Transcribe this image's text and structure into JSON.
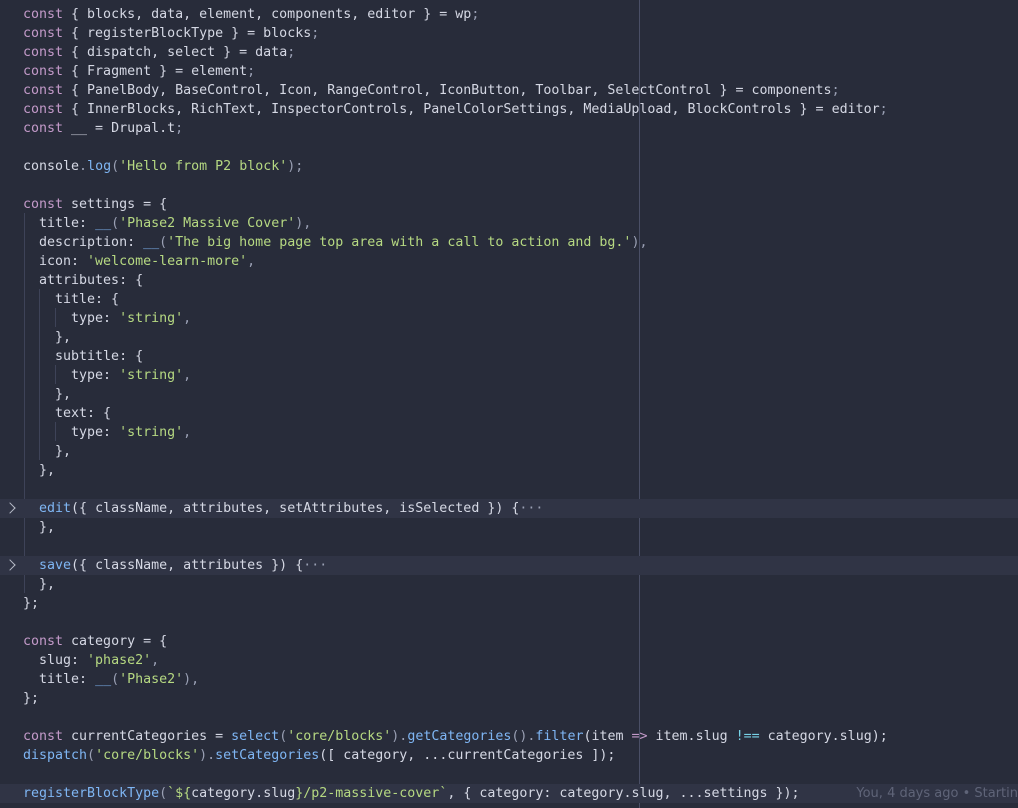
{
  "editor": {
    "lines": {
      "l1": {
        "a": "const",
        "b": " { blocks, data, element, components, editor } = ",
        "c": "wp",
        "d": ";"
      },
      "l2": {
        "a": "const",
        "b": " { registerBlockType } = ",
        "c": "blocks",
        "d": ";"
      },
      "l3": {
        "a": "const",
        "b": " { dispatch, select } = ",
        "c": "data",
        "d": ";"
      },
      "l4": {
        "a": "const",
        "b": " { Fragment } = ",
        "c": "element",
        "d": ";"
      },
      "l5": {
        "a": "const",
        "b": " { PanelBody, BaseControl, Icon, RangeControl, IconButton, Toolbar, SelectControl } = ",
        "c": "components",
        "d": ";"
      },
      "l6": {
        "a": "const",
        "b": " { InnerBlocks, RichText, InspectorControls, PanelColorSettings, MediaUpload, BlockControls } = ",
        "c": "editor",
        "d": ";"
      },
      "l7": {
        "a": "const",
        "b": " __ = ",
        "c": "Drupal.t",
        "d": ";"
      },
      "l9": {
        "a": "console",
        "b": ".",
        "c": "log",
        "d": "(",
        "e": "'Hello from P2 block'",
        "f": ");"
      },
      "l11": {
        "a": "const",
        "b": " settings = {"
      },
      "l12": {
        "a": "  title: ",
        "b": "__",
        "c": "(",
        "d": "'Phase2 Massive Cover'",
        "e": "),"
      },
      "l13": {
        "a": "  description: ",
        "b": "__",
        "c": "(",
        "d": "'The big home page top area with a call to action and bg.'",
        "e": "),"
      },
      "l14": {
        "a": "  icon: ",
        "b": "'welcome-learn-more'",
        "c": ","
      },
      "l15": {
        "a": "  attributes: {"
      },
      "l16": {
        "a": "    title: {"
      },
      "l17": {
        "a": "      type: ",
        "b": "'string'",
        "c": ","
      },
      "l18": {
        "a": "    },"
      },
      "l19": {
        "a": "    subtitle: {"
      },
      "l20": {
        "a": "      type: ",
        "b": "'string'",
        "c": ","
      },
      "l21": {
        "a": "    },"
      },
      "l22": {
        "a": "    text: {"
      },
      "l23": {
        "a": "      type: ",
        "b": "'string'",
        "c": ","
      },
      "l24": {
        "a": "    },"
      },
      "l25": {
        "a": "  },"
      },
      "l27": {
        "a": "  ",
        "b": "edit",
        "c": "({ className, attributes, setAttributes, isSelected }) {",
        "d": "···"
      },
      "l28": {
        "a": "  },"
      },
      "l30": {
        "a": "  ",
        "b": "save",
        "c": "({ className, attributes }) {",
        "d": "···"
      },
      "l31": {
        "a": "  },"
      },
      "l32": {
        "a": "};"
      },
      "l34": {
        "a": "const",
        "b": " category = {"
      },
      "l35": {
        "a": "  slug: ",
        "b": "'phase2'",
        "c": ","
      },
      "l36": {
        "a": "  title: ",
        "b": "__",
        "c": "(",
        "d": "'Phase2'",
        "e": "),"
      },
      "l37": {
        "a": "};"
      },
      "l39": {
        "a": "const",
        "b": " currentCategories = ",
        "c": "select",
        "d": "(",
        "e": "'core/blocks'",
        "f": ").",
        "g": "getCategories",
        "h": "().",
        "i": "filter",
        "j": "(item ",
        "k": "=>",
        "l": " item.slug ",
        "m": "!==",
        "n": " category.slug);"
      },
      "l40": {
        "a": "dispatch",
        "b": "(",
        "c": "'core/blocks'",
        "d": ").",
        "e": "setCategories",
        "f": "([ category, ...currentCategories ]);"
      },
      "l42": {
        "a": "registerBlockType",
        "b": "(",
        "c": "`${",
        "d": "category.slug",
        "e": "}/p2-massive-cover`",
        "f": ", { category: category.slug, ...settings });"
      }
    },
    "blame": "You, 4 days ago • Startin"
  }
}
